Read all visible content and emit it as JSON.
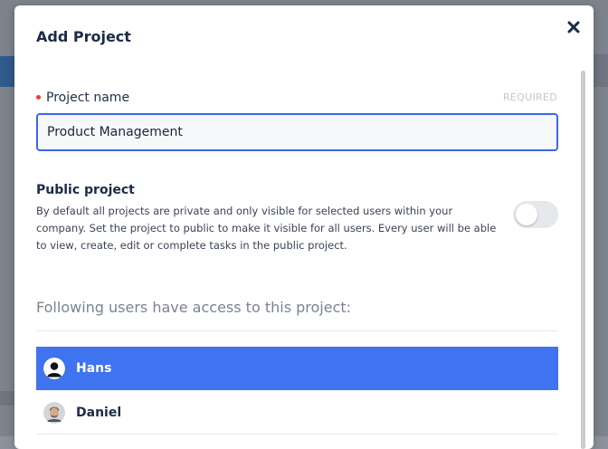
{
  "dialog": {
    "title": "Add Project",
    "close_icon": "close-icon"
  },
  "project_name": {
    "label": "Project name",
    "required_text": "REQUIRED",
    "value": "Product Management"
  },
  "public_project": {
    "title": "Public project",
    "description": "By default all projects are private and only visible for selected users within your company. Set the project to public to make it visible for all users. Every user will be able to view, create, edit or complete tasks in the public project.",
    "enabled": false
  },
  "access": {
    "title": "Following users have access to this project:",
    "users": [
      {
        "name": "Hans",
        "selected": true,
        "avatar_icon": "user-silhouette-avatar"
      },
      {
        "name": "Daniel",
        "selected": false,
        "avatar_icon": "user-photo-avatar"
      }
    ]
  },
  "colors": {
    "accent": "#3f73ef",
    "input_border": "#3b67e8",
    "required_dot": "#e0452c",
    "title_text": "#1d2b45"
  }
}
